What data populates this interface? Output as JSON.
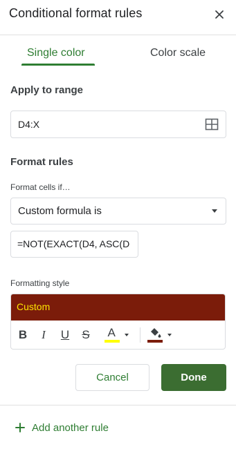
{
  "header": {
    "title": "Conditional format rules"
  },
  "tabs": [
    {
      "label": "Single color",
      "active": true
    },
    {
      "label": "Color scale",
      "active": false
    }
  ],
  "apply_range": {
    "label": "Apply to range",
    "value": "D4:X"
  },
  "format_rules": {
    "label": "Format rules",
    "condition_label": "Format cells if…",
    "condition_value": "Custom formula is",
    "formula_value": "=NOT(EXACT(D4, ASC(D"
  },
  "formatting_style": {
    "label": "Formatting style",
    "preview_text": "Custom",
    "preview_bg_color": "#7b1c0a",
    "preview_text_color": "#ffe600",
    "toolbar": {
      "bold": "B",
      "italic": "I",
      "underline": "U",
      "strikethrough": "S",
      "text_color_glyph": "A",
      "text_color": "#ffff00",
      "fill_color": "#7b1c0a"
    }
  },
  "actions": {
    "cancel_label": "Cancel",
    "done_label": "Done"
  },
  "add_rule": {
    "label": "Add another rule"
  },
  "colors": {
    "accent": "#2e7d32",
    "done_bg": "#3b6d31"
  }
}
